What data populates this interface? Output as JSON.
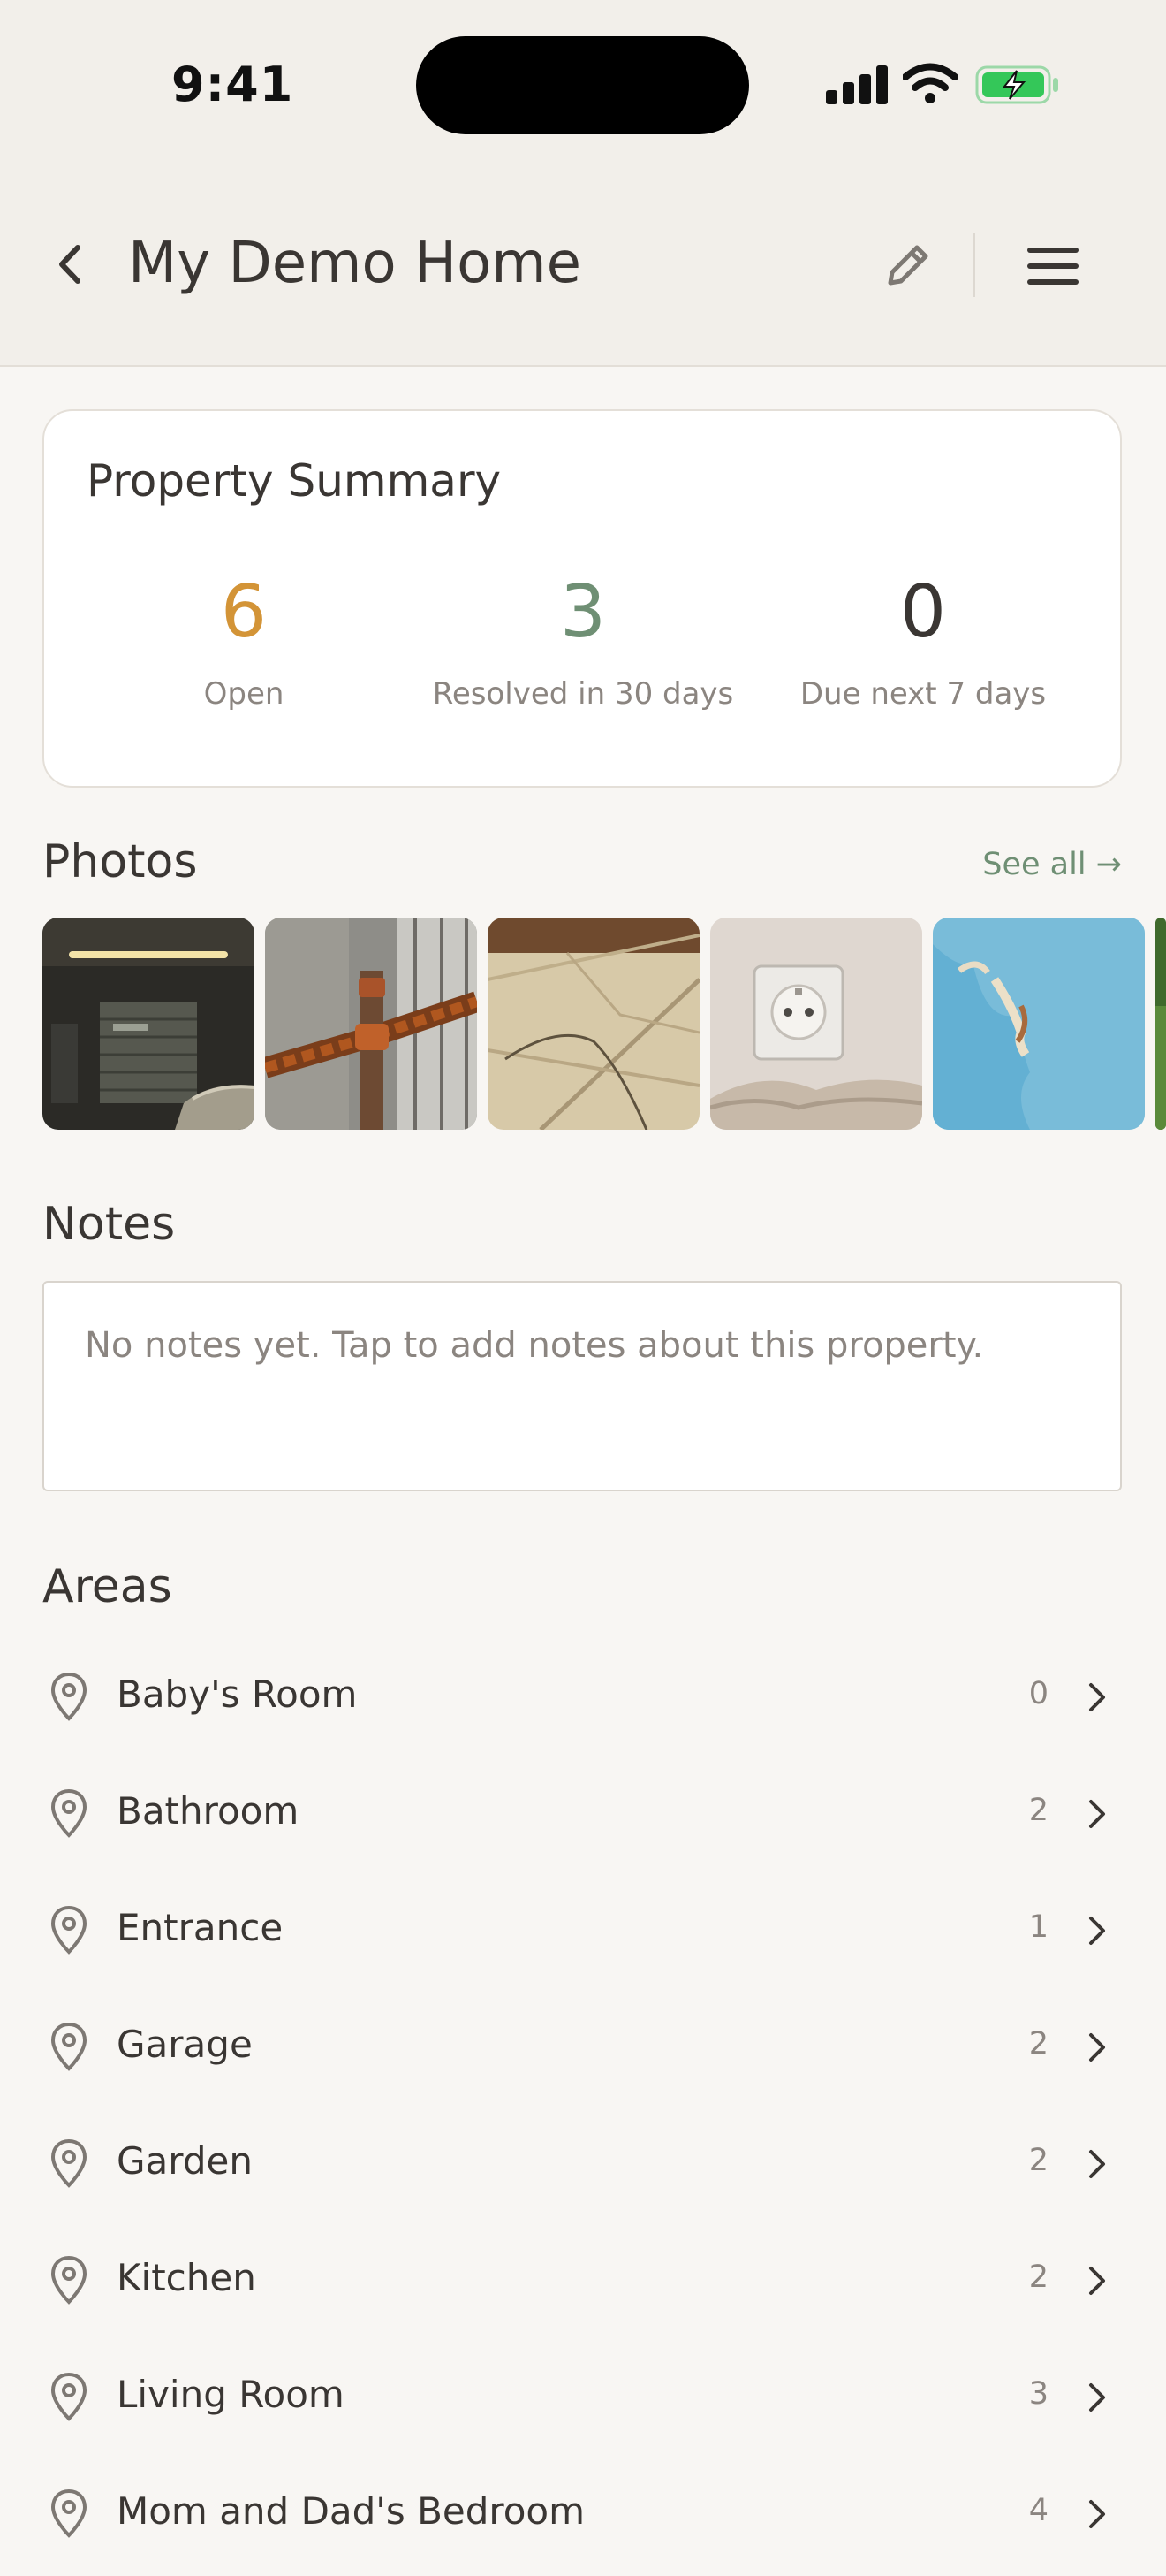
{
  "status_bar": {
    "time": "9:41",
    "icons": [
      "signal-icon",
      "wifi-icon",
      "battery-charging-icon"
    ],
    "battery_color": "#34c759"
  },
  "header": {
    "title": "My Demo Home",
    "back_icon": "chevron-left-icon",
    "edit_icon": "pencil-icon",
    "menu_icon": "hamburger-menu-icon"
  },
  "summary": {
    "title": "Property Summary",
    "stats": [
      {
        "value": "6",
        "label": "Open",
        "color": "#d39437"
      },
      {
        "value": "3",
        "label": "Resolved in 30 days",
        "color": "#6f8f74"
      },
      {
        "value": "0",
        "label": "Due next 7 days",
        "color": "#3a3633"
      }
    ]
  },
  "photos": {
    "title": "Photos",
    "see_all": "See all →",
    "items": [
      "garage-photo",
      "rusty-pipe-photo",
      "cracked-tile-photo",
      "wall-socket-photo",
      "peeling-paint-photo",
      "garden-photo"
    ]
  },
  "notes": {
    "title": "Notes",
    "placeholder": "No notes yet. Tap to add notes about this property."
  },
  "areas": {
    "title": "Areas",
    "items": [
      {
        "name": "Baby's Room",
        "count": "0"
      },
      {
        "name": "Bathroom",
        "count": "2"
      },
      {
        "name": "Entrance",
        "count": "1"
      },
      {
        "name": "Garage",
        "count": "2"
      },
      {
        "name": "Garden",
        "count": "2"
      },
      {
        "name": "Kitchen",
        "count": "2"
      },
      {
        "name": "Living Room",
        "count": "3"
      },
      {
        "name": "Mom and Dad's Bedroom",
        "count": "4"
      }
    ]
  }
}
